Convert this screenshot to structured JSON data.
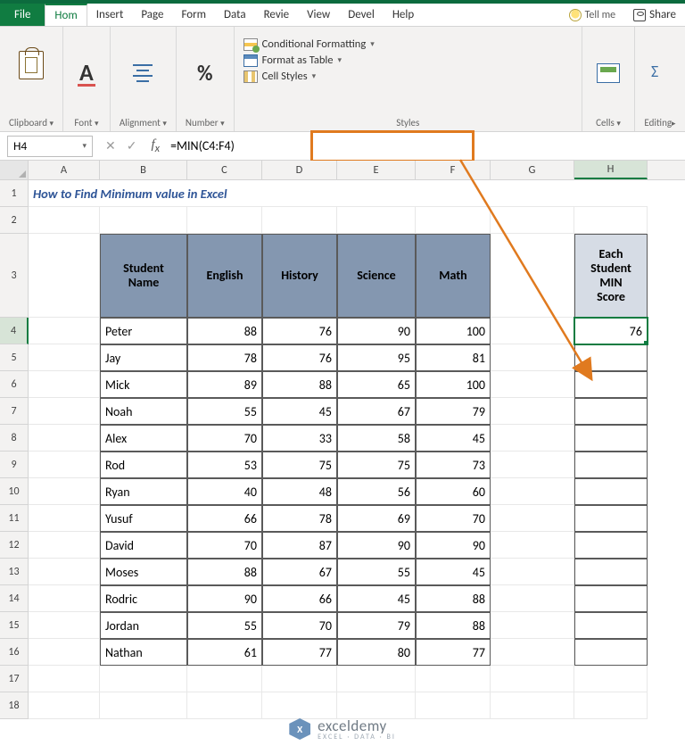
{
  "tabs": {
    "file": "File",
    "list": [
      "Hom",
      "Insert",
      "Page",
      "Form",
      "Data",
      "Revie",
      "View",
      "Devel",
      "Help"
    ],
    "active_index": 0,
    "tell_me": "Tell me",
    "share": "Share"
  },
  "ribbon": {
    "clipboard": {
      "label": "Clipboard",
      "paste": "Paste"
    },
    "font": {
      "label": "Font"
    },
    "alignment": {
      "label": "Alignment"
    },
    "number": {
      "label": "Number"
    },
    "styles": {
      "label": "Styles",
      "conditional": "Conditional Formatting",
      "table": "Format as Table",
      "cellstyles": "Cell Styles"
    },
    "cells": {
      "label": "Cells"
    },
    "editing": {
      "label": "Editing"
    }
  },
  "formula_bar": {
    "name_box": "H4",
    "formula": "=MIN(C4:F4)"
  },
  "columns": [
    "A",
    "B",
    "C",
    "D",
    "E",
    "F",
    "G",
    "H"
  ],
  "selected_col": "H",
  "selected_row": 4,
  "sheet": {
    "title": "How to Find Minimum value in Excel",
    "header": {
      "student": "Student Name",
      "subjects": [
        "English",
        "History",
        "Science",
        "Math"
      ],
      "min": "Each Student MIN Score"
    },
    "rows": [
      {
        "n": 4,
        "name": "Peter",
        "s": [
          88,
          76,
          90,
          100
        ],
        "min": 76
      },
      {
        "n": 5,
        "name": "Jay",
        "s": [
          78,
          76,
          95,
          81
        ],
        "min": ""
      },
      {
        "n": 6,
        "name": "Mick",
        "s": [
          89,
          88,
          65,
          100
        ],
        "min": ""
      },
      {
        "n": 7,
        "name": "Noah",
        "s": [
          55,
          45,
          67,
          79
        ],
        "min": ""
      },
      {
        "n": 8,
        "name": "Alex",
        "s": [
          70,
          33,
          58,
          45
        ],
        "min": ""
      },
      {
        "n": 9,
        "name": "Rod",
        "s": [
          53,
          75,
          75,
          73
        ],
        "min": ""
      },
      {
        "n": 10,
        "name": "Ryan",
        "s": [
          40,
          48,
          56,
          60
        ],
        "min": ""
      },
      {
        "n": 11,
        "name": "Yusuf",
        "s": [
          66,
          78,
          69,
          70
        ],
        "min": ""
      },
      {
        "n": 12,
        "name": "David",
        "s": [
          70,
          87,
          90,
          90
        ],
        "min": ""
      },
      {
        "n": 13,
        "name": "Moses",
        "s": [
          88,
          67,
          55,
          45
        ],
        "min": ""
      },
      {
        "n": 14,
        "name": "Rodric",
        "s": [
          90,
          66,
          45,
          88
        ],
        "min": ""
      },
      {
        "n": 15,
        "name": "Jordan",
        "s": [
          55,
          70,
          79,
          88
        ],
        "min": ""
      },
      {
        "n": 16,
        "name": "Nathan",
        "s": [
          61,
          77,
          80,
          77
        ],
        "min": ""
      }
    ],
    "extra_rows": [
      17,
      18
    ]
  },
  "watermark": {
    "brand": "exceldemy",
    "sub": "EXCEL · DATA · BI",
    "hex": "X"
  }
}
